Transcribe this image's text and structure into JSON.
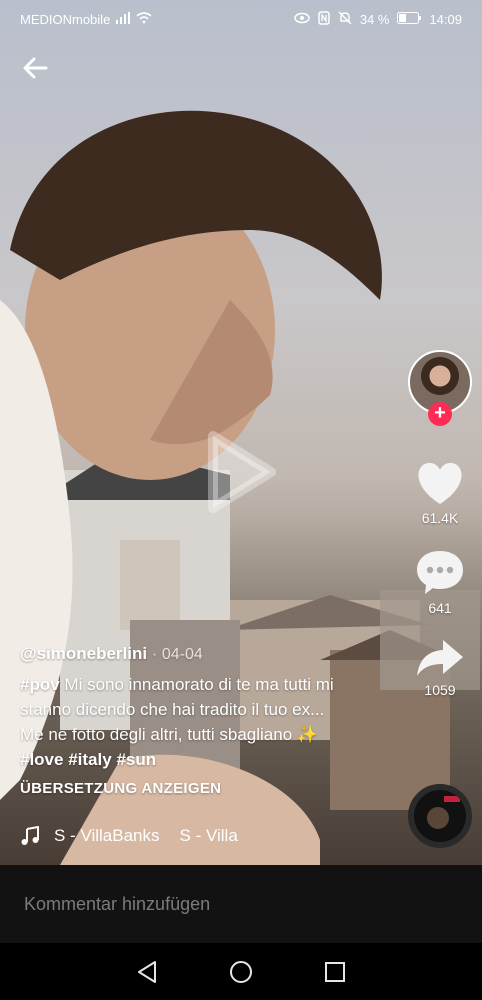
{
  "status": {
    "carrier": "MEDIONmobile",
    "battery": "34 %",
    "time": "14:09"
  },
  "post": {
    "handle": "@simoneberlini",
    "date_sep": "·",
    "date": "04-04",
    "desc_tag1": "#pov",
    "desc_text": "Mi sono innamorato di te ma tutti mi stanno dicendo che hai tradito il tuo ex... Me ne fotto degli altri, tutti sbagliano",
    "sparkle": "✨",
    "tags": [
      "#love",
      "#italy",
      "#sun"
    ],
    "translate": "ÜBERSETZUNG ANZEIGEN",
    "music": "S - VillaBanks",
    "music_repeat": "S - Villa"
  },
  "actions": {
    "likes": "61.4K",
    "comments": "641",
    "shares": "1059"
  },
  "comment": {
    "placeholder": "Kommentar hinzufügen"
  },
  "colors": {
    "accent": "#fe2c55",
    "comment_bar": "#121212"
  },
  "icons": [
    "back-arrow-icon",
    "heart-icon",
    "comment-icon",
    "share-icon",
    "music-note-icon",
    "play-icon",
    "plus-icon"
  ]
}
